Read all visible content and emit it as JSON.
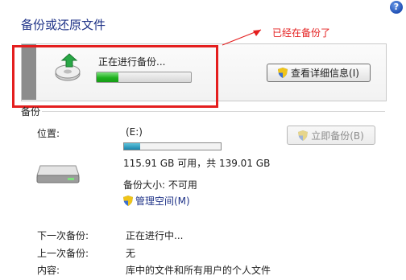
{
  "header": {
    "title": "备份或还原文件",
    "help_label": "?"
  },
  "status_panel": {
    "progress_text": "正在进行备份...",
    "progress_fraction": 0.23,
    "details_button_label": "查看详细信息(I)"
  },
  "annotation": {
    "text": "已经在备份了",
    "color": "#e41e1e"
  },
  "backup_section": {
    "section_title": "备份",
    "location_label": "位置:",
    "drive": "(E:)",
    "disk_used_fraction": 0.17,
    "disk_free_text": "115.91 GB 可用，共 139.01 GB",
    "backup_size_text": "备份大小: 不可用",
    "manage_space_link": "管理空间(M)",
    "backup_now_button": "立即备份(B)",
    "next_backup_label": "下一次备份:",
    "next_backup_value": "正在进行中...",
    "last_backup_label": "上一次备份:",
    "last_backup_value": "无",
    "contents_label": "内容:",
    "contents_value": "库中的文件和所有用户的个人文件"
  },
  "colors": {
    "title": "#1e3287",
    "red": "#e41e1e",
    "progress_green": "#1fb11f",
    "disk_blue": "#1b84ab"
  },
  "icons": [
    "help-icon",
    "backup-drive-icon",
    "shield-icon",
    "hard-drive-icon"
  ]
}
